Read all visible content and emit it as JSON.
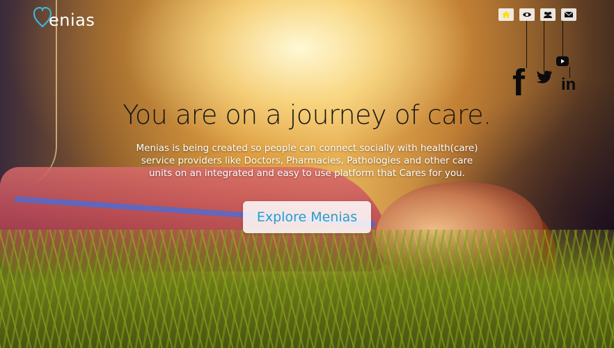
{
  "brand": {
    "name": "enias"
  },
  "nav": {
    "items": [
      "home-icon",
      "eye-icon",
      "users-icon",
      "envelope-icon"
    ],
    "active_color": "#f5e21a"
  },
  "social": {
    "facebook": "f",
    "twitter": "twitter-icon",
    "youtube": "youtube-icon",
    "linkedin": "in"
  },
  "hero": {
    "headline": "You are on a journey of care.",
    "description": "Menias is being created so people can connect socially with health(care) service providers like Doctors, Pharmacies, Pathologies and other care units on an integrated and easy to use platform that Cares for you.",
    "cta_label": "Explore Menias"
  },
  "colors": {
    "accent": "#2a9bc8",
    "logo_heart": "#3ab7d8"
  }
}
